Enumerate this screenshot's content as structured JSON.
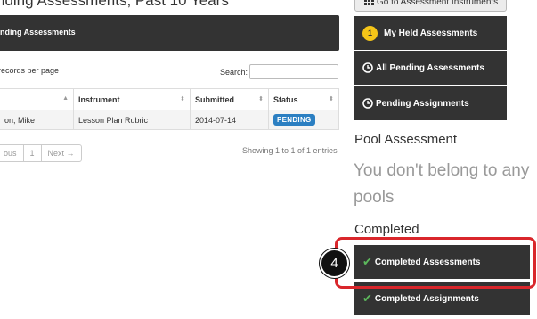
{
  "page": {
    "title": "nding Assessments, Past 10 Years",
    "section_header": "nding Assessments"
  },
  "table_controls": {
    "per_page_label": "records per page",
    "search_label": "Search:",
    "search_value": ""
  },
  "table": {
    "columns": [
      "",
      "Instrument",
      "Submitted",
      "Status"
    ],
    "rows": [
      {
        "name": "on, Mike",
        "instrument": "Lesson Plan Rubric",
        "submitted": "2014-07-14",
        "status": "PENDING"
      }
    ]
  },
  "pagination": {
    "previous": "ous",
    "page": "1",
    "next": "Next →",
    "showing": "Showing 1 to 1 of 1 entries"
  },
  "sidebar": {
    "instruments_button": "Go to Assessment Instruments",
    "held_count": "1",
    "held_label": "My Held Assessments",
    "all_pending_label": "All Pending Assessments",
    "pending_assignments_label": "Pending Assignments",
    "pool_heading": "Pool Assessment",
    "pool_message": "You don't belong to any pools",
    "completed_heading": "Completed",
    "completed_assessments_label": "Completed Assessments",
    "completed_assignments_label": "Completed Assignments"
  },
  "callout": {
    "step_number": "4",
    "color": "#d9262b"
  },
  "icons": {
    "instruments": "grid-icon",
    "all_pending": "clock-icon",
    "pending_assignments": "clock-icon",
    "completed": "check-icon"
  },
  "colors": {
    "dark_panel": "#333333",
    "badge_yellow": "#f5c518",
    "pending_badge": "#2b7fc2",
    "check_green": "#5cb85c"
  }
}
